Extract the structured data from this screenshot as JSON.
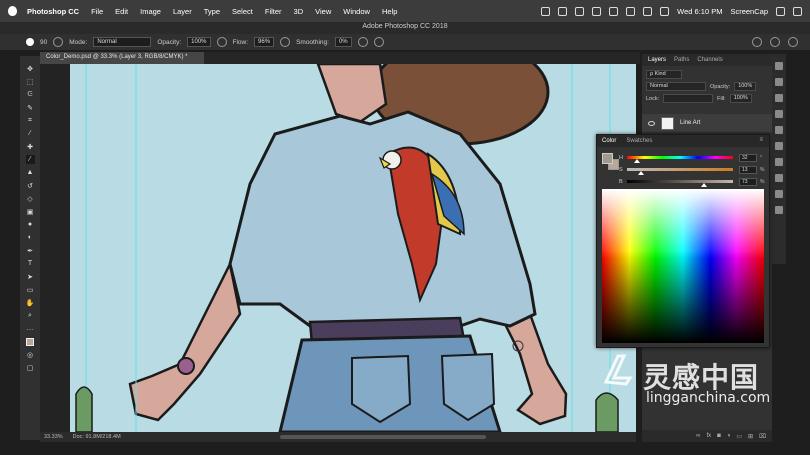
{
  "menubar": {
    "app_name": "Photoshop CC",
    "items": [
      "File",
      "Edit",
      "Image",
      "Layer",
      "Type",
      "Select",
      "Filter",
      "3D",
      "View",
      "Window",
      "Help"
    ],
    "clock": "Wed 6:10 PM",
    "user": "ScreenCap"
  },
  "window": {
    "title": "Adobe Photoshop CC 2018"
  },
  "options_bar": {
    "brush_size": "90",
    "mode_label": "Mode:",
    "mode_value": "Normal",
    "opacity_label": "Opacity:",
    "opacity_value": "100%",
    "flow_label": "Flow:",
    "flow_value": "96%",
    "smoothing_label": "Smoothing:",
    "smoothing_value": "0%"
  },
  "document": {
    "tab_title": "Color_Demo.psd @ 33.3% (Layer 3, RGB/8/CMYK) *",
    "zoom": "33.33%",
    "doc_info": "Doc: 91.8M/218.4M"
  },
  "layers_panel": {
    "tabs": [
      "Layers",
      "Paths",
      "Channels"
    ],
    "kind_filter": "ρ Kind",
    "blend_mode": "Normal",
    "opacity_label": "Opacity:",
    "opacity_value": "100%",
    "lock_label": "Lock:",
    "fill_label": "Fill:",
    "fill_value": "100%",
    "layer_name": "Line Art",
    "footer_icons": [
      "link",
      "fx",
      "mask",
      "adjust",
      "folder",
      "new",
      "trash"
    ]
  },
  "color_panel": {
    "tabs": [
      "Color",
      "Swatches"
    ],
    "h_label": "H",
    "h_value": "32",
    "h_unit": "°",
    "s_label": "S",
    "s_value": "13",
    "s_unit": "%",
    "b_label": "B",
    "b_value": "73",
    "b_unit": "%",
    "h_fraction": 0.09,
    "s_fraction": 0.13,
    "b_fraction": 0.73,
    "foreground": "#a39a8f",
    "background": "#b9a79a"
  },
  "watermark": {
    "cn_text": "灵感中国",
    "en_text": "lingganchina.com"
  },
  "colors": {
    "canvas_bg": "#b9dbe3",
    "shirt": "#a8c7d9",
    "skin": "#d6a79b",
    "hat": "#7a5138",
    "belt": "#4b3e5c",
    "jeans": "#6e95ba",
    "parrot_red": "#c13a2a",
    "guide": "#63e1e8"
  }
}
